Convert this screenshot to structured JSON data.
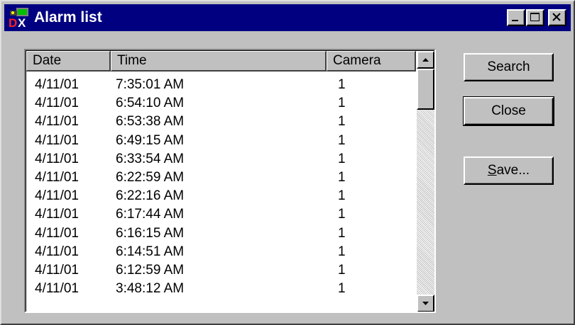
{
  "window": {
    "title": "Alarm list",
    "icon": "camera-dx-app-icon"
  },
  "caption_buttons": [
    "minimize",
    "maximize",
    "close"
  ],
  "list": {
    "columns": [
      "Date",
      "Time",
      "Camera"
    ],
    "rows": [
      {
        "date": "4/11/01",
        "time": "7:35:01 AM",
        "camera": "1"
      },
      {
        "date": "4/11/01",
        "time": "6:54:10 AM",
        "camera": "1"
      },
      {
        "date": "4/11/01",
        "time": "6:53:38 AM",
        "camera": "1"
      },
      {
        "date": "4/11/01",
        "time": "6:49:15 AM",
        "camera": "1"
      },
      {
        "date": "4/11/01",
        "time": "6:33:54 AM",
        "camera": "1"
      },
      {
        "date": "4/11/01",
        "time": "6:22:59 AM",
        "camera": "1"
      },
      {
        "date": "4/11/01",
        "time": "6:22:16 AM",
        "camera": "1"
      },
      {
        "date": "4/11/01",
        "time": "6:17:44 AM",
        "camera": "1"
      },
      {
        "date": "4/11/01",
        "time": "6:16:15 AM",
        "camera": "1"
      },
      {
        "date": "4/11/01",
        "time": "6:14:51 AM",
        "camera": "1"
      },
      {
        "date": "4/11/01",
        "time": "6:12:59 AM",
        "camera": "1"
      },
      {
        "date": "4/11/01",
        "time": "3:48:12 AM",
        "camera": "1"
      }
    ]
  },
  "buttons": {
    "search": "Search",
    "close": "Close",
    "save_mnemonic": "S",
    "save_rest": "ave..."
  },
  "colors": {
    "titlebar": "#000080",
    "face": "#c0c0c0"
  }
}
